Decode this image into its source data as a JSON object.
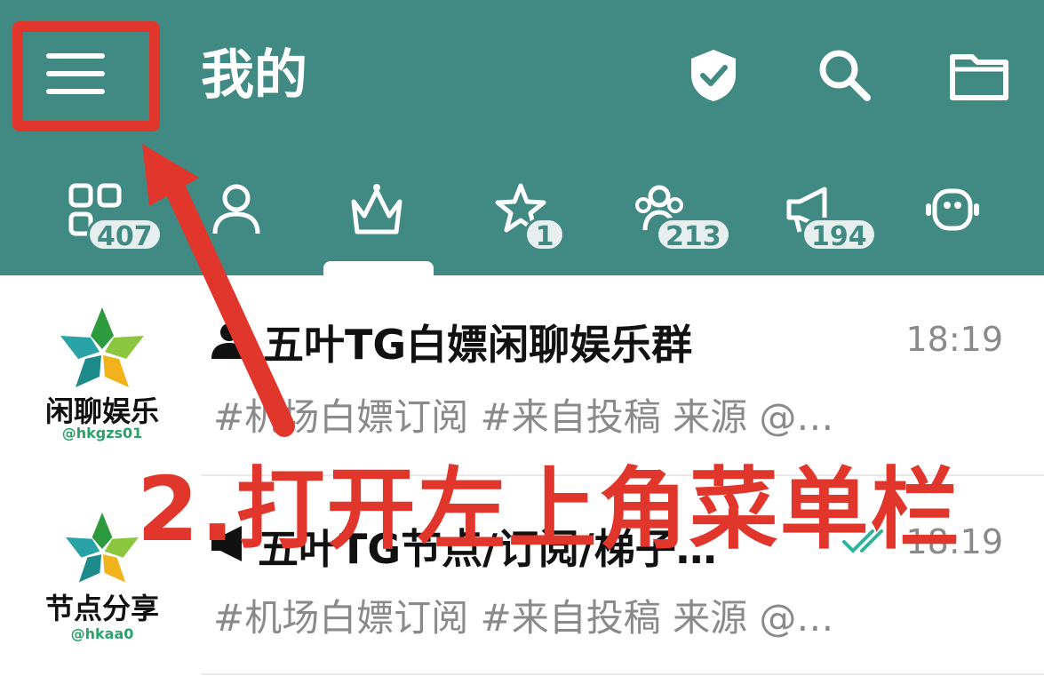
{
  "header": {
    "title": "我的",
    "icons": [
      "menu-icon",
      "shield-check-icon",
      "search-icon",
      "folder-icon"
    ]
  },
  "tabs": [
    {
      "icon": "apps-grid-icon",
      "badge": "407"
    },
    {
      "icon": "person-icon",
      "badge": ""
    },
    {
      "icon": "crown-icon",
      "badge": "",
      "selected": true
    },
    {
      "icon": "star-icon",
      "badge": "1"
    },
    {
      "icon": "group-icon",
      "badge": "213"
    },
    {
      "icon": "megaphone-icon",
      "badge": "194"
    },
    {
      "icon": "bot-icon",
      "badge": ""
    }
  ],
  "chats": [
    {
      "type_icon": "group-icon",
      "name": "五叶TG白嫖闲聊娱乐群",
      "time": "18:19",
      "preview": "#机场白嫖订阅 #来自投稿  来源 @…",
      "avatar_title": "闲聊娱乐",
      "avatar_handle": "@hkgzs01",
      "read_status": ""
    },
    {
      "type_icon": "megaphone-icon",
      "name": "五叶TG节点/订阅/梯子…",
      "time": "18:19",
      "preview": "#机场白嫖订阅 #来自投稿  来源 @…",
      "avatar_title": "节点分享",
      "avatar_handle": "@hkaa0",
      "read_status": "double-check-icon"
    }
  ],
  "annotation": {
    "text": "2.打开左上角菜单栏",
    "color": "#e0362b"
  },
  "colors": {
    "header_bg": "#418a84",
    "accent_red": "#e0362b",
    "check_green": "#2bb5a0"
  }
}
